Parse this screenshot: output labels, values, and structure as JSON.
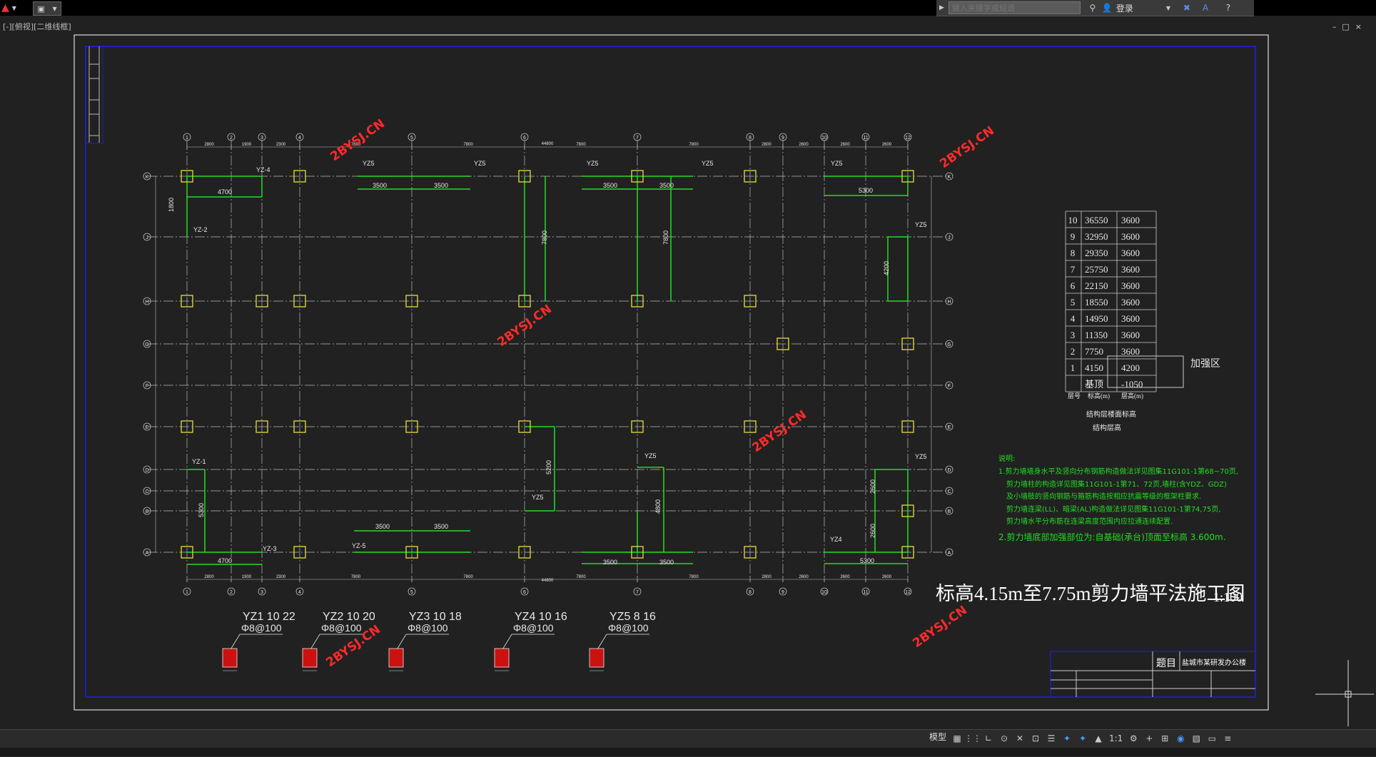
{
  "toolbar": {
    "search_placeholder": "键入关键字或短语",
    "login_label": "登录"
  },
  "viewport": {
    "label": "[-][俯视][二维线框]"
  },
  "drawing": {
    "title": "标高4.15m至7.75m剪力墙平法施工图",
    "scale": "1:100",
    "watermark": "2BYSJ.CN",
    "grid_top": [
      "1",
      "2",
      "3",
      "4",
      "5",
      "6",
      "7",
      "8",
      "9",
      "10",
      "11",
      "12"
    ],
    "grid_bottom": [
      "1",
      "2",
      "3",
      "4",
      "5",
      "6",
      "7",
      "8",
      "9",
      "10",
      "11",
      "12"
    ],
    "grid_left": [
      "K",
      "J",
      "H",
      "G",
      "F",
      "E",
      "D",
      "C",
      "B",
      "A"
    ],
    "top_dims": [
      "2800",
      "1900",
      "2300",
      "7800",
      "7800",
      "7800",
      "7800",
      "2800",
      "2600",
      "2600",
      "2600",
      "2600"
    ],
    "overall_dim": "44800",
    "wall_dims": {
      "d4700a": "4700",
      "d3500a": "3500",
      "d3500b": "3500",
      "d3500c": "3500",
      "d3500d": "3500",
      "d5300a": "5300",
      "d7800a": "7800",
      "d7800b": "7800",
      "d4200": "4200",
      "d5200": "5200",
      "d4800": "4800",
      "d5300b": "5300",
      "d2600a": "2600",
      "d2600b": "2600",
      "d3500e": "3500",
      "d3500f": "3500",
      "d4700b": "4700",
      "d3500g": "3500",
      "d3500h": "3500",
      "d5300c": "5300",
      "d1800": "1800"
    },
    "wall_labels": {
      "yz1": "YZ-1",
      "yz2": "YZ-2",
      "yz3": "YZ-3",
      "yz4": "YZ-4",
      "yz5": "YZ-5",
      "yz5a": "YZ5",
      "yz5b": "YZ5",
      "yz5c": "YZ5",
      "yz5d": "YZ5",
      "yz5e": "YZ5",
      "yz5f": "YZ5",
      "yz5g": "YZ5",
      "yz5h": "YZ5",
      "yz5i": "YZ5",
      "yz4a": "YZ4"
    },
    "level_table": {
      "rows": [
        {
          "floor": "10",
          "elev": "36550",
          "height": "3600"
        },
        {
          "floor": "9",
          "elev": "32950",
          "height": "3600"
        },
        {
          "floor": "8",
          "elev": "29350",
          "height": "3600"
        },
        {
          "floor": "7",
          "elev": "25750",
          "height": "3600"
        },
        {
          "floor": "6",
          "elev": "22150",
          "height": "3600"
        },
        {
          "floor": "5",
          "elev": "18550",
          "height": "3600"
        },
        {
          "floor": "4",
          "elev": "14950",
          "height": "3600"
        },
        {
          "floor": "3",
          "elev": "11350",
          "height": "3600"
        },
        {
          "floor": "2",
          "elev": "7750",
          "height": "3600"
        },
        {
          "floor": "1",
          "elev": "4150",
          "height": "4200"
        },
        {
          "floor": "",
          "elev": "基顶",
          "height": "-1050"
        }
      ],
      "header_floor": "层号",
      "header_elev": "标高(m)",
      "header_height": "层高(m)",
      "caption1": "结构层楼面标高",
      "caption2": "结构层高",
      "zone_label": "加强区"
    },
    "notes": {
      "heading": "说明:",
      "lines": [
        "1.剪力墙墙身水平及竖向分布钢筋构造做法详见图集11G101-1第68~70页,",
        "剪力墙柱的构造详见图集11G101-1第71、72页,墙柱(含YDZ、GDZ)",
        "及小墙肢的竖向钢筋与箍筋构造按相应抗震等级的框架柱要求.",
        "剪力墙连梁(LL)、暗梁(AL)构造做法详见图集11G101-1第74,75页,",
        "剪力墙水平分布筋在连梁高度范围内应拉通连续配置.",
        "2.剪力墙底部加强部位为:自基础(承台)顶面至标高 3.600m."
      ]
    },
    "columns": [
      {
        "name": "YZ1",
        "spec": "10 22",
        "stirrup": "Φ8@100"
      },
      {
        "name": "YZ2",
        "spec": "10 20",
        "stirrup": "Φ8@100"
      },
      {
        "name": "YZ3",
        "spec": "10 18",
        "stirrup": "Φ8@100"
      },
      {
        "name": "YZ4",
        "spec": "10 16",
        "stirrup": "Φ8@100"
      },
      {
        "name": "YZ5",
        "spec": "8 16",
        "stirrup": "Φ8@100"
      }
    ],
    "title_block": {
      "label": "题目",
      "project": "盐城市某研发办公楼"
    }
  },
  "statusbar": {
    "model_label": "模型",
    "scale_label": "1:1"
  },
  "colors": {
    "background": "#212121",
    "frame": "#1f1fb5",
    "grid": "#bbbbbb",
    "wall": "#22dd22",
    "column": "#d8d040",
    "watermark": "#ff2a2a",
    "text": "#e8e8e8"
  }
}
